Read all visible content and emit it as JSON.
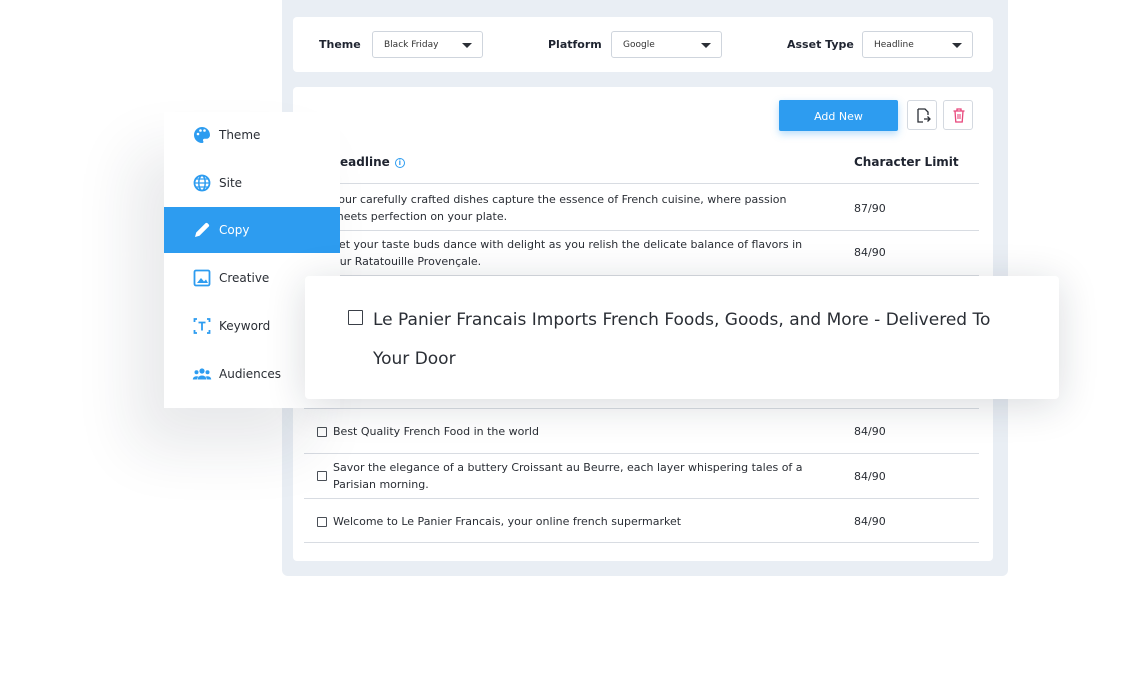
{
  "filters": {
    "theme": {
      "label": "Theme",
      "value": "Black Friday"
    },
    "platform": {
      "label": "Platform",
      "value": "Google"
    },
    "asset_type": {
      "label": "Asset Type",
      "value": "Headline"
    }
  },
  "toolbar": {
    "add_new_label": "Add New",
    "export_icon": "export-icon",
    "delete_icon": "trash-icon"
  },
  "table": {
    "headers": {
      "headline": "Headline",
      "limit": "Character Limit"
    },
    "rows_top": [
      {
        "text": "Your carefully crafted dishes capture the essence of French cuisine, where passion meets perfection on your plate.",
        "limit": "87/90"
      },
      {
        "text": "Let your taste buds dance with delight as you relish the delicate balance of flavors in our Ratatouille Provençale.",
        "limit": "84/90"
      }
    ],
    "rows_bottom": [
      {
        "text": "Best Quality French Food in the world",
        "limit": "84/90"
      },
      {
        "text": "Savor the elegance of a buttery Croissant au Beurre, each layer whispering tales of a Parisian morning.",
        "limit": "84/90"
      },
      {
        "text": "Welcome to Le Panier Francais, your online french supermarket",
        "limit": "84/90"
      }
    ]
  },
  "highlight": {
    "text": "Le Panier Francais Imports French Foods, Goods, and More - Delivered To Your Door"
  },
  "sidebar": {
    "items": [
      {
        "label": "Theme",
        "icon": "palette-icon",
        "active": false
      },
      {
        "label": "Site",
        "icon": "globe-icon",
        "active": false
      },
      {
        "label": "Copy",
        "icon": "pen-icon",
        "active": true
      },
      {
        "label": "Creative",
        "icon": "image-icon",
        "active": false
      },
      {
        "label": "Keyword",
        "icon": "keyword-icon",
        "active": false
      },
      {
        "label": "Audiences",
        "icon": "users-icon",
        "active": false
      }
    ]
  },
  "colors": {
    "accent": "#2d9cf0",
    "delete": "#e8457a",
    "shell": "#e9eef4"
  }
}
